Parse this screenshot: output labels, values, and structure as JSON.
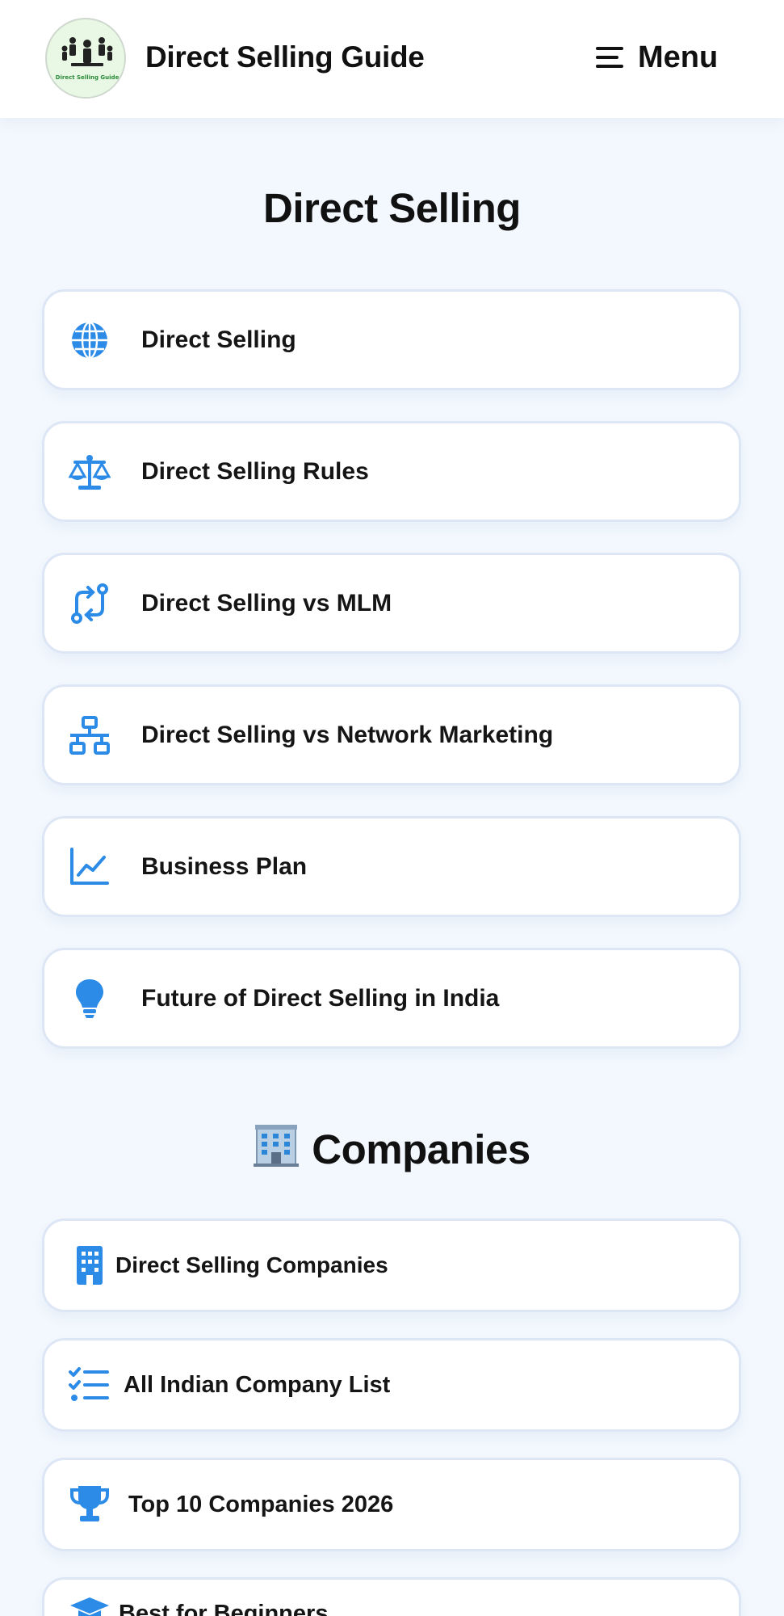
{
  "header": {
    "site_title": "Direct Selling Guide",
    "menu_label": "Menu",
    "logo_text": "Direct Selling Guide"
  },
  "section_direct_selling": {
    "title": "Direct Selling",
    "items": [
      {
        "label": "Direct Selling",
        "icon": "globe-icon"
      },
      {
        "label": "Direct Selling Rules",
        "icon": "scale-icon"
      },
      {
        "label": "Direct Selling vs MLM",
        "icon": "exchange-icon"
      },
      {
        "label": "Direct Selling vs Network Marketing",
        "icon": "network-icon"
      },
      {
        "label": "Business Plan",
        "icon": "chart-line-icon"
      },
      {
        "label": "Future of Direct Selling in India",
        "icon": "lightbulb-icon"
      }
    ]
  },
  "section_companies": {
    "title": "Companies",
    "title_icon": "office-building-icon",
    "items": [
      {
        "label": "Direct Selling Companies",
        "icon": "building-icon"
      },
      {
        "label": "All Indian Company List",
        "icon": "checklist-icon"
      },
      {
        "label": "Top 10 Companies 2026",
        "icon": "trophy-icon"
      },
      {
        "label": "Best for Beginners",
        "icon": "graduation-cap-icon"
      }
    ]
  },
  "colors": {
    "accent": "#2b8be6",
    "background": "#f3f8fe",
    "card_border": "#dde6f5"
  }
}
